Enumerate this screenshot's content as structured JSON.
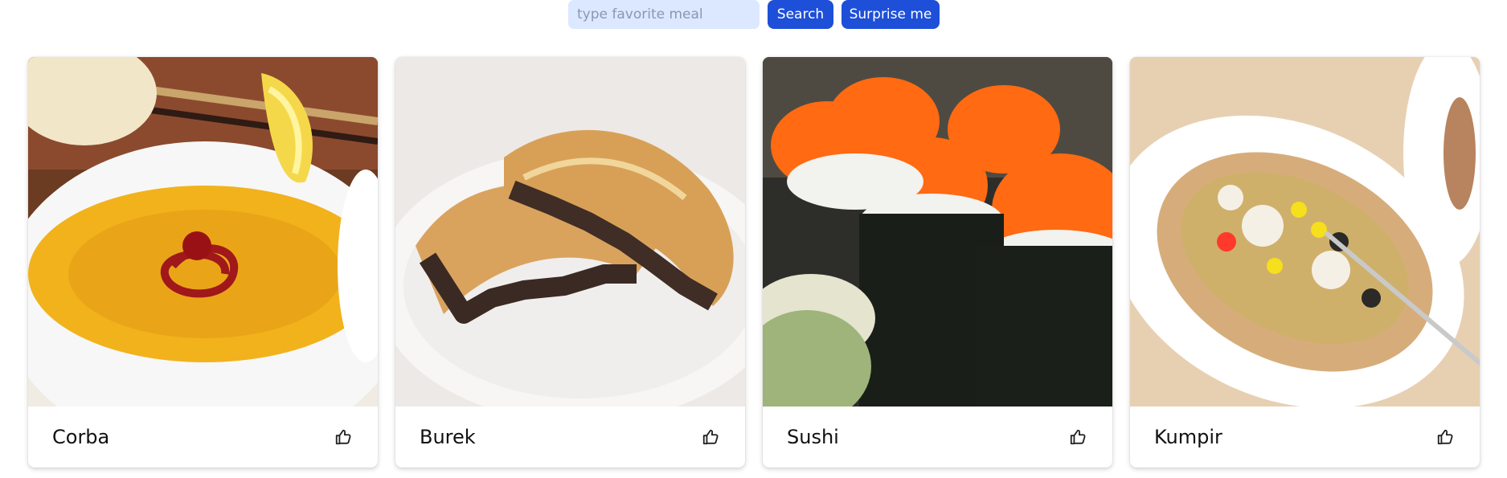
{
  "search": {
    "placeholder": "type favorite meal",
    "value": ""
  },
  "buttons": {
    "search_label": "Search",
    "surprise_label": "Surprise me"
  },
  "colors": {
    "accent": "#1e4fd8",
    "input_bg": "#dce8ff"
  },
  "cards": [
    {
      "title": "Corba",
      "icon": "thumbs-up-icon"
    },
    {
      "title": "Burek",
      "icon": "thumbs-up-icon"
    },
    {
      "title": "Sushi",
      "icon": "thumbs-up-icon"
    },
    {
      "title": "Kumpir",
      "icon": "thumbs-up-icon"
    }
  ]
}
